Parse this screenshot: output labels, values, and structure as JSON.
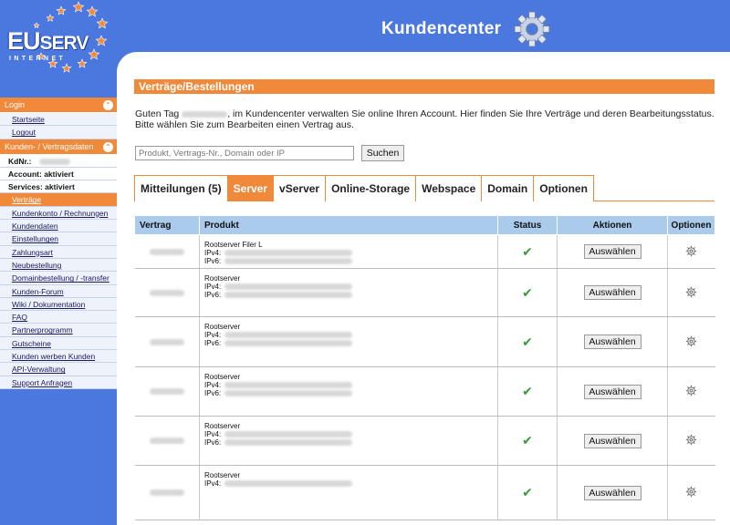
{
  "brand": {
    "wordmark_eu": "EU",
    "wordmark_serv": "SERV",
    "wordmark_sub": "INTERNET",
    "header_title": "Kundencenter",
    "star_color": "#f08a3a",
    "header_bg": "#4a78de",
    "accent": "#f08a3a"
  },
  "sidebar": {
    "login_head": "Login",
    "login_items": [
      "Startseite",
      "Logout"
    ],
    "data_head": "Kunden- / Vertragsdaten",
    "kdnr_label": "KdNr.:",
    "account_status": "Account: aktiviert",
    "services_status": "Services: aktiviert",
    "items": [
      "Verträge",
      "Kundenkonto / Rechnungen",
      "Kundendaten",
      "Einstellungen",
      "Zahlungsart",
      "Neubestellung",
      "Domainbestellung / -transfer",
      "Kunden-Forum",
      "Wiki / Dokumentation",
      "FAQ",
      "Partnerprogramm",
      "Gutscheine",
      "Kunden werben Kunden",
      "API-Verwaltung",
      "Support Anfragen"
    ],
    "toggle_icon": "collapse-icon"
  },
  "main": {
    "section_title": "Verträge/Bestellungen",
    "greeting_before": "Guten Tag ",
    "greeting_after": ", im Kundencenter verwalten Sie online Ihren Account. Hier finden Sie Ihre Verträge und deren Bearbeitungsstatus. Bitte wählen Sie zum Bearbeiten einen Vertrag aus.",
    "search": {
      "placeholder": "Produkt, Vertrags-Nr., Domain oder IP",
      "button": "Suchen"
    },
    "tabs": [
      "Mitteilungen (5)",
      "Server",
      "vServer",
      "Online-Storage",
      "Webspace",
      "Domain",
      "Optionen"
    ],
    "active_tab": "Server",
    "table": {
      "headers": [
        "Vertrag",
        "Produkt",
        "Status",
        "Aktionen",
        "Optionen"
      ],
      "ipv4_label": "IPv4:",
      "ipv6_label": "IPv6:",
      "action_label": "Auswählen",
      "status_icon": "checkmark-icon",
      "options_icon": "gear-icon",
      "rows": [
        {
          "product": "Rootserver Filer L",
          "has_ipv6": true
        },
        {
          "product": "Rootserver",
          "has_ipv6": true
        },
        {
          "product": "Rootserver",
          "has_ipv6": true
        },
        {
          "product": "Rootserver",
          "has_ipv6": true
        },
        {
          "product": "Rootserver",
          "has_ipv6": true
        },
        {
          "product": "Rootserver",
          "has_ipv6": false
        }
      ]
    }
  }
}
